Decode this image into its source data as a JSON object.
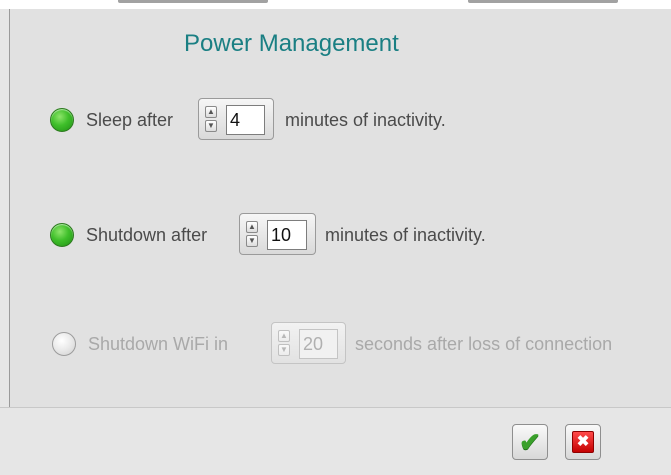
{
  "dialog": {
    "title": "Power Management",
    "rows": [
      {
        "label_before": "Sleep after",
        "value": "4",
        "label_after": "minutes of inactivity.",
        "selected": true,
        "enabled": true
      },
      {
        "label_before": "Shutdown after",
        "value": "10",
        "label_after": "minutes of inactivity.",
        "selected": true,
        "enabled": true
      },
      {
        "label_before": "Shutdown WiFi in",
        "value": "20",
        "label_after": "seconds after loss of connection",
        "selected": false,
        "enabled": false
      }
    ],
    "icons": {
      "spin_up": "▲",
      "spin_down": "▼",
      "ok": "✔",
      "cancel": "✖"
    },
    "colors": {
      "title": "#1a7f83",
      "ok_green": "#3aa02b",
      "cancel_red": "#d40000"
    }
  }
}
